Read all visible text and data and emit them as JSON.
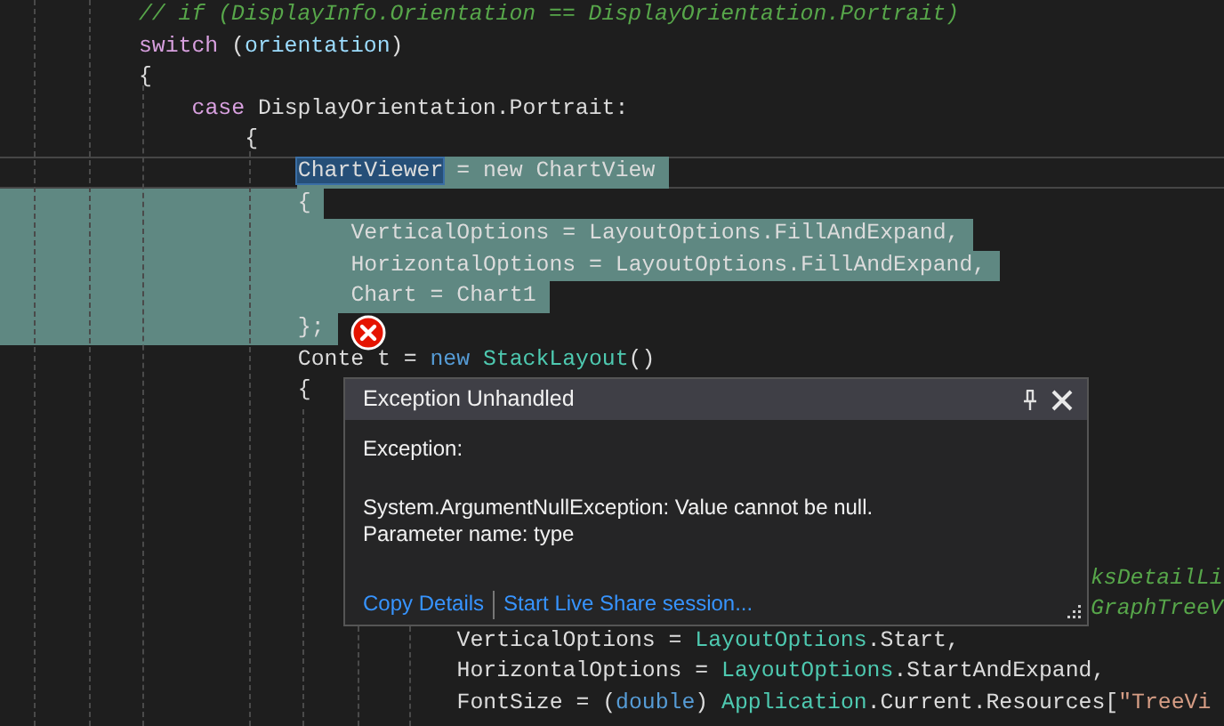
{
  "editor": {
    "lines": [
      {
        "selected": false,
        "current": false,
        "tokens": [
          {
            "kind": "comment",
            "text": "// if (DisplayInfo.Orientation == DisplayOrientation.Portrait)"
          }
        ]
      },
      {
        "selected": false,
        "current": false,
        "tokens": [
          {
            "kind": "control",
            "text": "switch"
          },
          {
            "kind": "plain",
            "text": " ("
          },
          {
            "kind": "variable",
            "text": "orientation"
          },
          {
            "kind": "plain",
            "text": ")"
          }
        ]
      },
      {
        "selected": false,
        "current": false,
        "tokens": [
          {
            "kind": "plain",
            "text": "{"
          }
        ],
        "children": [
          {
            "selected": false,
            "current": false,
            "tokens": [
              {
                "kind": "control",
                "text": "case"
              },
              {
                "kind": "plain",
                "text": " DisplayOrientation.Portrait:"
              }
            ],
            "children": [
              {
                "selected": false,
                "current": false,
                "tokens": [
                  {
                    "kind": "plain",
                    "text": "{"
                  }
                ],
                "children": [
                  {
                    "selected": true,
                    "current": true,
                    "tokens": [
                      {
                        "kind": "match",
                        "text": "ChartViewer"
                      },
                      {
                        "kind": "plain",
                        "text": " = new ChartView"
                      }
                    ]
                  },
                  {
                    "selected": true,
                    "current": false,
                    "tokens": [
                      {
                        "kind": "plain",
                        "text": "{"
                      }
                    ],
                    "children": [
                      {
                        "selected": true,
                        "current": false,
                        "tokens": [
                          {
                            "kind": "plain",
                            "text": "VerticalOptions = LayoutOptions.FillAndExpand,"
                          }
                        ]
                      },
                      {
                        "selected": true,
                        "current": false,
                        "tokens": [
                          {
                            "kind": "plain",
                            "text": "HorizontalOptions = LayoutOptions.FillAndExpand,"
                          }
                        ]
                      },
                      {
                        "selected": true,
                        "current": false,
                        "tokens": [
                          {
                            "kind": "plain",
                            "text": "Chart = Chart1"
                          }
                        ]
                      }
                    ]
                  },
                  {
                    "selected": true,
                    "current": false,
                    "tokens": [
                      {
                        "kind": "plain",
                        "text": "};"
                      }
                    ]
                  },
                  {
                    "selected": false,
                    "current": false,
                    "tokens": [
                      {
                        "kind": "plain",
                        "text": "Conte t = "
                      },
                      {
                        "kind": "keyword",
                        "text": "new "
                      },
                      {
                        "kind": "type",
                        "text": "StackLayout"
                      },
                      {
                        "kind": "plain",
                        "text": "()"
                      }
                    ]
                  },
                  {
                    "selected": false,
                    "current": false,
                    "tokens": [
                      {
                        "kind": "plain",
                        "text": "{"
                      }
                    ],
                    "children": [
                      {
                        "kind": "covered",
                        "children": [
                          {
                            "kind": "covered",
                            "children": [
                              {
                                "kind": "covered"
                              },
                              {
                                "kind": "covered"
                              },
                              {
                                "kind": "covered"
                              },
                              {
                                "kind": "tail",
                                "selected": false,
                                "current": false,
                                "tokens": [
                                  {
                                    "kind": "comment",
                                    "text": "ksDetailLi"
                                  }
                                ]
                              },
                              {
                                "kind": "tail",
                                "selected": false,
                                "current": false,
                                "tokens": [
                                  {
                                    "kind": "comment",
                                    "text": "GraphTreeV"
                                  }
                                ]
                              },
                              {
                                "selected": false,
                                "current": false,
                                "tokens": [
                                  {
                                    "kind": "plain",
                                    "text": "VerticalOptions = "
                                  },
                                  {
                                    "kind": "type",
                                    "text": "LayoutOptions"
                                  },
                                  {
                                    "kind": "plain",
                                    "text": ".Start,"
                                  }
                                ]
                              },
                              {
                                "selected": false,
                                "current": false,
                                "tokens": [
                                  {
                                    "kind": "plain",
                                    "text": "HorizontalOptions = "
                                  },
                                  {
                                    "kind": "type",
                                    "text": "LayoutOptions"
                                  },
                                  {
                                    "kind": "plain",
                                    "text": ".StartAndExpand,"
                                  }
                                ]
                              },
                              {
                                "selected": false,
                                "current": false,
                                "tokens": [
                                  {
                                    "kind": "plain",
                                    "text": "FontSize = ("
                                  },
                                  {
                                    "kind": "keyword",
                                    "text": "double"
                                  },
                                  {
                                    "kind": "plain",
                                    "text": ") "
                                  },
                                  {
                                    "kind": "type",
                                    "text": "Application"
                                  },
                                  {
                                    "kind": "plain",
                                    "text": ".Current.Resources["
                                  },
                                  {
                                    "kind": "string",
                                    "text": "\"TreeVi"
                                  }
                                ]
                              }
                            ]
                          }
                        ]
                      }
                    ]
                  }
                ]
              }
            ]
          }
        ]
      }
    ]
  },
  "exception_popup": {
    "title": "Exception Unhandled",
    "heading": "Exception:",
    "message": [
      "System.ArgumentNullException: Value cannot be null.",
      "Parameter name: type"
    ],
    "links": [
      "Copy Details",
      "Start Live Share session..."
    ]
  }
}
